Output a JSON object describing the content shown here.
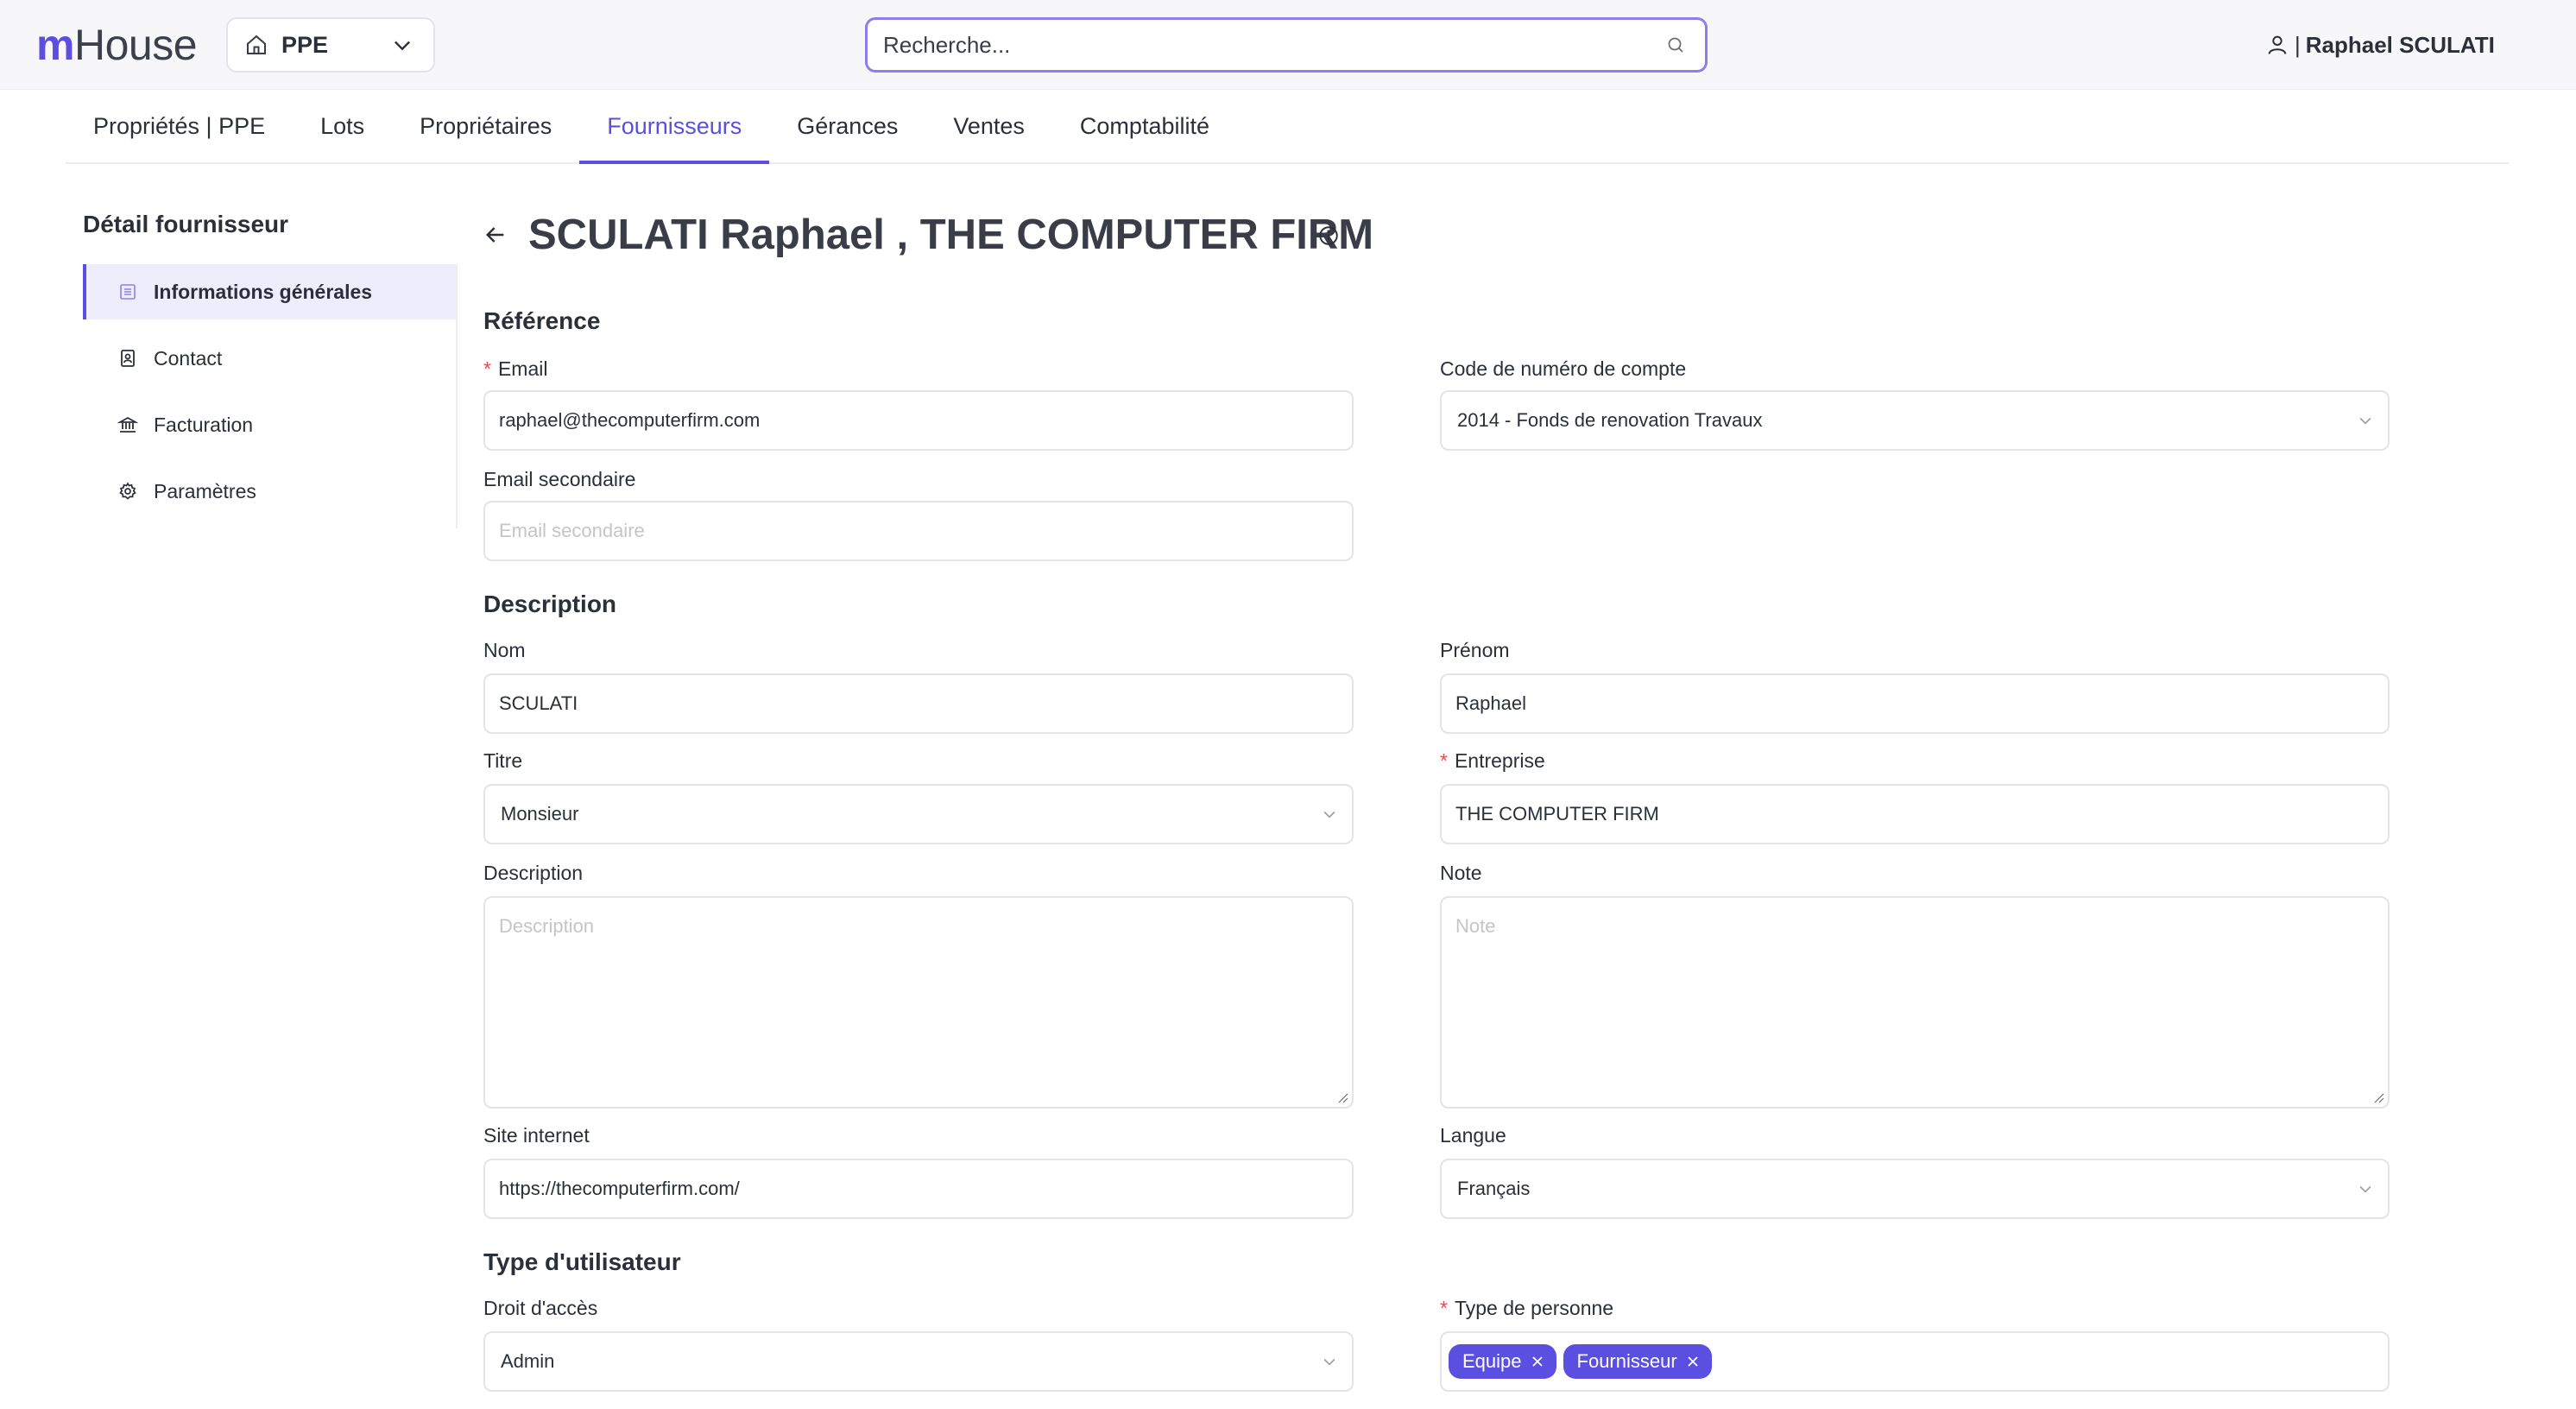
{
  "header": {
    "logo_m": "m",
    "logo_house": "House",
    "property_selector": "PPE",
    "search_placeholder": "Recherche...",
    "user_separator": "|",
    "user_name": "Raphael SCULATI"
  },
  "tabs": [
    {
      "label": "Propriétés | PPE"
    },
    {
      "label": "Lots"
    },
    {
      "label": "Propriétaires"
    },
    {
      "label": "Fournisseurs",
      "active": true
    },
    {
      "label": "Gérances"
    },
    {
      "label": "Ventes"
    },
    {
      "label": "Comptabilité"
    }
  ],
  "sidebar": {
    "title": "Détail fournisseur",
    "items": [
      {
        "label": "Informations générales",
        "icon": "list-icon",
        "active": true
      },
      {
        "label": "Contact",
        "icon": "contact-icon"
      },
      {
        "label": "Facturation",
        "icon": "bank-icon"
      },
      {
        "label": "Paramètres",
        "icon": "gear-icon"
      }
    ]
  },
  "page": {
    "title": "SCULATI Raphael , THE COMPUTER FIRM"
  },
  "reference": {
    "section": "Référence",
    "email_label": "Email",
    "email_value": "raphael@thecomputerfirm.com",
    "account_code_label": "Code de numéro de compte",
    "account_code_value": "2014 - Fonds de renovation Travaux",
    "secondary_email_label": "Email secondaire",
    "secondary_email_placeholder": "Email secondaire"
  },
  "description": {
    "section": "Description",
    "nom_label": "Nom",
    "nom_value": "SCULATI",
    "prenom_label": "Prénom",
    "prenom_value": "Raphael",
    "titre_label": "Titre",
    "titre_value": "Monsieur",
    "entreprise_label": "Entreprise",
    "entreprise_value": "THE COMPUTER FIRM",
    "description_label": "Description",
    "description_placeholder": "Description",
    "note_label": "Note",
    "note_placeholder": "Note",
    "site_label": "Site internet",
    "site_value": "https://thecomputerfirm.com/",
    "langue_label": "Langue",
    "langue_value": "Français"
  },
  "user_type": {
    "section": "Type d'utilisateur",
    "access_label": "Droit d'accès",
    "access_value": "Admin",
    "person_type_label": "Type de personne",
    "tags": [
      "Equipe",
      "Fournisseur"
    ]
  },
  "colors": {
    "accent": "#5a4fe0",
    "required": "#e24b4b"
  }
}
